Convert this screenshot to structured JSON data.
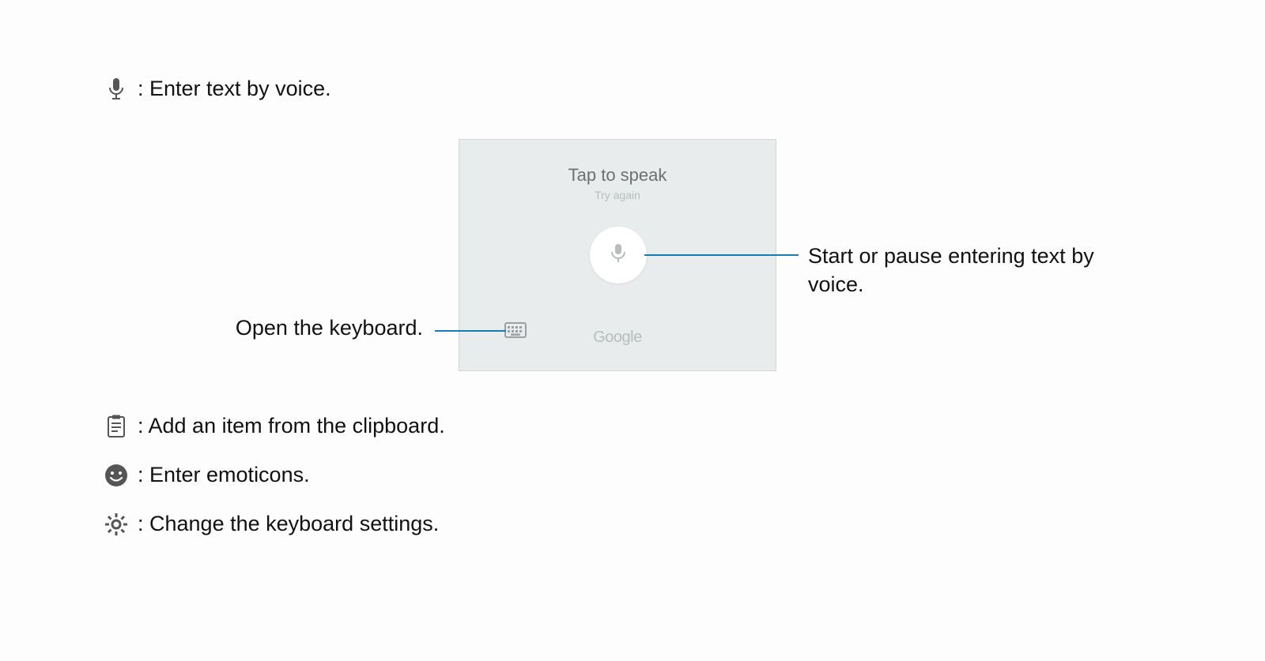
{
  "bullets": {
    "voice": ": Enter text by voice.",
    "clipboard": ": Add an item from the clipboard.",
    "emoticons": ": Enter emoticons.",
    "settings": ": Change the keyboard settings."
  },
  "panel": {
    "title": "Tap to speak",
    "subtitle": "Try again",
    "logo": "Google"
  },
  "callouts": {
    "mic": "Start or pause entering text by voice.",
    "keyboard": "Open the keyboard."
  }
}
